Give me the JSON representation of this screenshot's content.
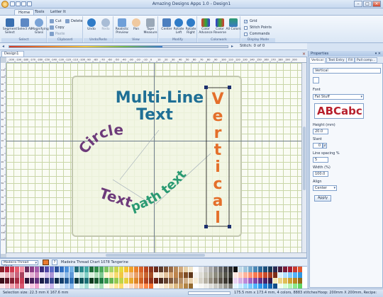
{
  "app": {
    "title": "Amazing Designs Apps 1.0 - Design1",
    "tabs": [
      "Home",
      "Tools",
      "Letter It"
    ]
  },
  "ribbon": {
    "select": {
      "label": "Select",
      "buttons": [
        "Segment Select",
        "Select All",
        "Magnifying Glass"
      ]
    },
    "clipboard": {
      "label": "Clipboard",
      "items": [
        "Cut",
        "Delete",
        "Copy",
        "Paste"
      ]
    },
    "undo": {
      "label": "Undo/Redo",
      "buttons": [
        "Undo",
        "Redo"
      ]
    },
    "view": {
      "label": "View",
      "buttons": [
        "Realistic Preview",
        "Pan",
        "Tape Measure"
      ]
    },
    "modify": {
      "label": "Modify",
      "buttons": [
        "Center",
        "Rotate Left",
        "Rotate Right"
      ]
    },
    "colorwork": {
      "label": "Colorwork",
      "buttons": [
        "Color Advance",
        "Color Reverse",
        "All Colors"
      ]
    },
    "display": {
      "label": "Display Mode",
      "checks": [
        {
          "label": "Grid",
          "checked": true
        },
        {
          "label": "Stitch Points",
          "checked": false
        },
        {
          "label": "Commands",
          "checked": false
        }
      ]
    }
  },
  "progress": {
    "fraction": 0.7,
    "stitch_label": "Stitch:",
    "stitch_value": "0 of 0"
  },
  "document": {
    "tab": "Design1"
  },
  "ruler": {
    "top": [
      "-200",
      "-190",
      "-180",
      "-170",
      "-160",
      "-150",
      "-140",
      "-130",
      "-120",
      "-110",
      "-100",
      "-90",
      "-80",
      "-70",
      "-60",
      "-50",
      "-40",
      "-30",
      "-20",
      "-10",
      "0",
      "10",
      "20",
      "30",
      "40",
      "50",
      "60",
      "70",
      "80",
      "90",
      "100",
      "110",
      "120",
      "130",
      "140",
      "150",
      "160",
      "170",
      "180",
      "190",
      "200"
    ],
    "left": [
      "110",
      "100",
      "90",
      "80",
      "70",
      "60",
      "50",
      "40",
      "30",
      "20",
      "10",
      "0",
      "10",
      "20",
      "30",
      "40",
      "50",
      "60",
      "70",
      "80",
      "90",
      "100",
      "110",
      "120",
      "130"
    ]
  },
  "design": {
    "multiline": [
      "Multi-Line",
      "Text"
    ],
    "circle": "Circle",
    "text": "Text",
    "path_text": "path text",
    "vertical": [
      "V",
      "e",
      "r",
      "t",
      "i",
      "c",
      "a",
      "l"
    ],
    "colors": {
      "blue": "#1f6f95",
      "purple": "#6d3a7a",
      "green": "#2a9a72",
      "orange": "#e46f2a"
    }
  },
  "properties": {
    "title": "Properties",
    "tabs": [
      "Vertical",
      "Text Entry",
      "Fill",
      "Pull comp..."
    ],
    "text_value": "Vertical",
    "font_label": "Font",
    "font_value": "Fat Stuff",
    "preview_text": "ABCabc",
    "height_label": "Height (mm)",
    "height_value": "20.0",
    "slant_label": "Slant",
    "slant_value": "0",
    "spacing_label": "Line spacing %",
    "spacing_value": "5",
    "width_label": "Width (%)",
    "width_value": "100.0",
    "align_label": "Align",
    "align_value": "Center",
    "apply_label": "Apply"
  },
  "thread": {
    "chart": "Madeira Thread Chart",
    "selected": "Madeira Thread Chart 1078 Tangerine",
    "help": "?"
  },
  "palette": [
    [
      "#8a1f2a",
      "#b21f3b",
      "#d03a4f",
      "#e45a6e",
      "#f08aa0",
      "#6b2a5c",
      "#8d3d86",
      "#a45aa9",
      "#3b2c7a",
      "#4f46a6",
      "#5d6bc7",
      "#2a4f9a",
      "#2f6ec1",
      "#4a8fd8",
      "#72b1e6",
      "#1f6b75",
      "#2a8a8c",
      "#3ea8a1",
      "#1f6e3a",
      "#2f8c48",
      "#4aa85b",
      "#7cc35f",
      "#a8d46a",
      "#c9d34a",
      "#e7da3f",
      "#f3c330",
      "#f0a12a",
      "#e9812b",
      "#d85f27",
      "#b9441f",
      "#8a331b",
      "#6a2a1c",
      "#5c3a2a",
      "#7a4f33",
      "#9a6a43",
      "#b88a5a",
      "#d2aa7b",
      "#e6cfa6",
      "#f1e5cb",
      "#ffffff",
      "#e6e6e6",
      "#c9c9c9",
      "#a8a8a8",
      "#888888",
      "#666666",
      "#4a4a4a",
      "#2e2e2e",
      "#111111",
      "#c2dbe8",
      "#9fc5dc",
      "#74a9cb",
      "#4a87b5",
      "#2d6a9a",
      "#1d4f7a",
      "#163a5a",
      "#2a2a52",
      "#4a1e3e",
      "#7a1a36",
      "#a31e33",
      "#c9372f",
      "#e0572e"
    ],
    [
      "#f3d8dc",
      "#e9b3bc",
      "#da8c9b",
      "#c8637b",
      "#a8405c",
      "#f5d7e8",
      "#e4b1d3",
      "#cc86bc",
      "#ece1f5",
      "#cfbde9",
      "#ab95d6",
      "#e0ecf8",
      "#b9d3f0",
      "#8cb8e6",
      "#5d98d8",
      "#dff3f1",
      "#b3e2dc",
      "#82cfc5",
      "#d8f0dc",
      "#addfb7",
      "#7fc990",
      "#fff6cc",
      "#fbeaa0",
      "#f7da6e",
      "#f2c744",
      "#f8e0c2",
      "#f2c193",
      "#e9a068",
      "#de7f44",
      "#c8642f",
      "#a34d26",
      "#f7eee0",
      "#efdcc2",
      "#e3c29b",
      "#d3a371",
      "#bd844c",
      "#9e6735",
      "#7f4e26",
      "#5f381b",
      "#f2f2ee",
      "#deddd5",
      "#c4c3b8",
      "#a9a89b",
      "#8d8c7f",
      "#727165",
      "#57574d",
      "#3d3d35",
      "#ffe8e0",
      "#ffcfbf",
      "#ffb39c",
      "#ff9675",
      "#f7784f",
      "#e85e36",
      "#c94a28",
      "#a33b20",
      "#7c2d19",
      "#d9f2ff",
      "#b0e0ff",
      "#82cbff",
      "#52b2f7",
      "#2f95e0"
    ],
    [
      "#3a0f1a",
      "#5e1626",
      "#821f33",
      "#a62a41",
      "#c83a52",
      "#2b1238",
      "#45205a",
      "#62307d",
      "#1b1f4a",
      "#27306c",
      "#36468f",
      "#0f2a4a",
      "#163f6c",
      "#1f5690",
      "#2b6fb4",
      "#0b3a3f",
      "#11555b",
      "#197077",
      "#0f3b20",
      "#175a31",
      "#1f7a43",
      "#3b9a4f",
      "#65b552",
      "#93c94f",
      "#c0d44a",
      "#e6cf3a",
      "#e8a92c",
      "#df8426",
      "#cf5f22",
      "#b3421d",
      "#8d2f18",
      "#6a2214",
      "#4a2a1f",
      "#63402c",
      "#7e583d",
      "#99724f",
      "#b58e66",
      "#cfae87",
      "#e7cfaa",
      "#f6ecd8",
      "#d6d2c7",
      "#b6b1a4",
      "#968f82",
      "#777064",
      "#59534a",
      "#3d3932",
      "#24211d",
      "#ead4f2",
      "#d5b0e6",
      "#bd89d7",
      "#a162c4",
      "#8144a8",
      "#632f87",
      "#4a2268",
      "#33184a",
      "#f5e9b8",
      "#ebd485",
      "#dfbd55",
      "#cfa232",
      "#b8861e",
      "#946a15"
    ],
    [
      "#fbe3e7",
      "#f6c4cd",
      "#efa0ae",
      "#e47a8e",
      "#d8566f",
      "#fde9f4",
      "#f8c9e3",
      "#f0a3cf",
      "#f4effb",
      "#e3d6f5",
      "#cbb6ec",
      "#eef5fd",
      "#d4e6fa",
      "#b3d2f5",
      "#8abbee",
      "#eafaf8",
      "#c9efe9",
      "#a2e0d6",
      "#edf9ef",
      "#cdeed4",
      "#a6e0b4",
      "#fffbe6",
      "#fff3bf",
      "#ffe995",
      "#ffdc6b",
      "#fff0e2",
      "#ffdcc0",
      "#ffc499",
      "#ffa870",
      "#ff8a4a",
      "#f06d2e",
      "#fffaf2",
      "#fbf0dd",
      "#f4e1c2",
      "#ead0a3",
      "#dcb982",
      "#c99e61",
      "#b18344",
      "#94692f",
      "#ffffff",
      "#f7f7f4",
      "#ededea",
      "#dededa",
      "#cacac5",
      "#b3b3ad",
      "#9a9a93",
      "#7f7f78",
      "#e5f6ff",
      "#c5ebff",
      "#9fdcff",
      "#76caff",
      "#4eb5fb",
      "#2e9bef",
      "#1e7fd4",
      "#1565b1",
      "#0f4d8a",
      "#f0fff0",
      "#d6ffd6",
      "#b3f5b3",
      "#8be88b",
      "#62d662"
    ]
  ],
  "status": {
    "selection": "Selection size: 22.3 mm X 167.6 mm",
    "design_info": "175.5 mm x 173.4 mm, 4 colors, 8883 stitches",
    "hoop": "Hoop: 200mm X 200mm, Recipe: normal"
  }
}
